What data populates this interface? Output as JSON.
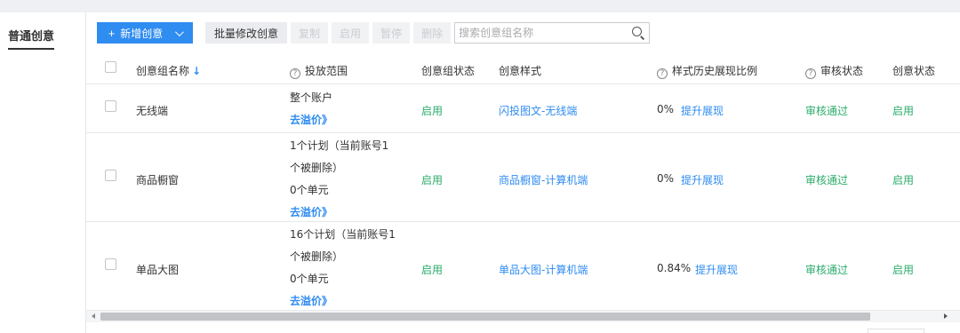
{
  "nav": {
    "tab_label": "普通创意"
  },
  "toolbar": {
    "add_label": "新增创意",
    "batch_edit_label": "批量修改创意",
    "copy_label": "复制",
    "enable_label": "启用",
    "pause_label": "暂停",
    "delete_label": "删除",
    "search_placeholder": "搜索创意组名称"
  },
  "table": {
    "headers": {
      "name": "创意组名称",
      "scope": "投放范围",
      "group_status": "创意组状态",
      "style": "创意样式",
      "history_ratio": "样式历史展现比例",
      "review_status": "审核状态",
      "creative_status": "创意状态"
    },
    "rows": [
      {
        "name": "无线端",
        "scope_lines": [
          "整个账户"
        ],
        "scope_link": "去溢价》",
        "group_status": "启用",
        "style": "闪投图文-无线端",
        "ratio": "0%",
        "boost": "提升展现",
        "review": "审核通过",
        "creative_status": "启用"
      },
      {
        "name": "商品橱窗",
        "scope_lines": [
          "1个计划（当前账号1",
          "个被删除）",
          "0个单元"
        ],
        "scope_link": "去溢价》",
        "group_status": "启用",
        "style": "商品橱窗-计算机端",
        "ratio": "0%",
        "boost": "提升展现",
        "review": "审核通过",
        "creative_status": "启用"
      },
      {
        "name": "单品大图",
        "scope_lines": [
          "16个计划（当前账号1",
          "个被删除）",
          "0个单元"
        ],
        "scope_link": "去溢价》",
        "group_status": "启用",
        "style": "单品大图-计算机端",
        "ratio": "0.84%",
        "boost": "提升展现",
        "review": "审核通过",
        "creative_status": "启用"
      }
    ]
  },
  "colors": {
    "primary": "#2f8cf0",
    "status_green": "#2aab6a"
  }
}
